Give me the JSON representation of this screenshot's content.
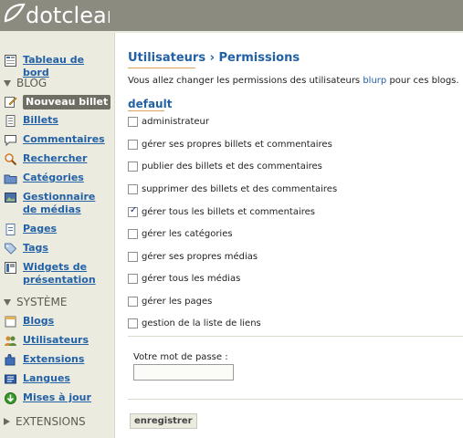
{
  "app": {
    "logo_text": "dotclear"
  },
  "sidebar": {
    "dashboard": "Tableau de bord",
    "sections": {
      "blog": "BLOG",
      "system": "SYSTÈME",
      "extensions": "EXTENSIONS"
    },
    "blog_items": [
      {
        "label": "Nouveau billet",
        "active": true
      },
      {
        "label": "Billets"
      },
      {
        "label": "Commentaires"
      },
      {
        "label": "Rechercher"
      },
      {
        "label": "Catégories"
      },
      {
        "label": "Gestionnaire de médias"
      },
      {
        "label": "Pages"
      },
      {
        "label": "Tags"
      },
      {
        "label": "Widgets de présentation"
      }
    ],
    "system_items": [
      {
        "label": "Blogs"
      },
      {
        "label": "Utilisateurs"
      },
      {
        "label": "Extensions"
      },
      {
        "label": "Langues"
      },
      {
        "label": "Mises à jour"
      }
    ]
  },
  "main": {
    "title": "Utilisateurs › Permissions",
    "intro_before": "Vous allez changer les permissions des utilisateurs ",
    "intro_link": "blurp",
    "intro_after": " pour ces blogs.",
    "blog_name": "default",
    "permissions": [
      {
        "label": "administrateur",
        "checked": false
      },
      {
        "label": "gérer ses propres billets et commentaires",
        "checked": false
      },
      {
        "label": "publier des billets et des commentaires",
        "checked": false
      },
      {
        "label": "supprimer des billets et des commentaires",
        "checked": false
      },
      {
        "label": "gérer tous les billets et commentaires",
        "checked": true
      },
      {
        "label": "gérer les catégories",
        "checked": false
      },
      {
        "label": "gérer ses propres médias",
        "checked": false
      },
      {
        "label": "gérer tous les médias",
        "checked": false
      },
      {
        "label": "gérer les pages",
        "checked": false
      },
      {
        "label": "gestion de la liste de liens",
        "checked": false
      }
    ],
    "password_label": "Votre mot de passe :",
    "password_value": "",
    "submit_label": "enregistrer"
  }
}
